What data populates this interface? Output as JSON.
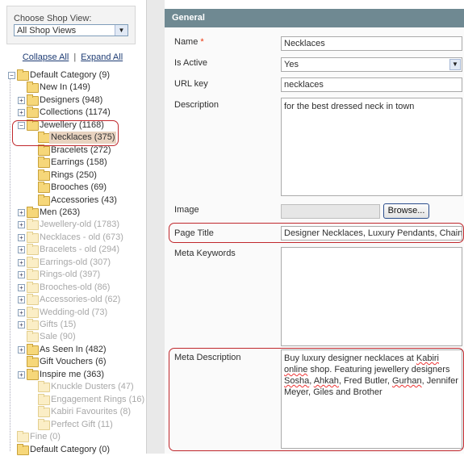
{
  "shop_view": {
    "label": "Choose Shop View:",
    "selected": "All Shop Views"
  },
  "tree_controls": {
    "collapse_all": "Collapse All",
    "separator": "|",
    "expand_all": "Expand All"
  },
  "tree": [
    {
      "label": "Default Category (9)",
      "exp": "−",
      "dim": false
    },
    {
      "label": "New In (149)",
      "exp": "",
      "dim": false
    },
    {
      "label": "Designers (948)",
      "exp": "+",
      "dim": false
    },
    {
      "label": "Collections (1174)",
      "exp": "+",
      "dim": false
    },
    {
      "label": "Jewellery (1168)",
      "exp": "−",
      "dim": false
    },
    {
      "label": "Necklaces (375)",
      "exp": "",
      "dim": false,
      "selected": true
    },
    {
      "label": "Bracelets (272)",
      "exp": "",
      "dim": false
    },
    {
      "label": "Earrings (158)",
      "exp": "",
      "dim": false
    },
    {
      "label": "Rings (250)",
      "exp": "",
      "dim": false
    },
    {
      "label": "Brooches (69)",
      "exp": "",
      "dim": false
    },
    {
      "label": "Accessories (43)",
      "exp": "",
      "dim": false
    },
    {
      "label": "Men (263)",
      "exp": "+",
      "dim": false
    },
    {
      "label": "Jewellery-old (1783)",
      "exp": "+",
      "dim": true
    },
    {
      "label": "Necklaces - old (673)",
      "exp": "+",
      "dim": true
    },
    {
      "label": "Bracelets - old (294)",
      "exp": "+",
      "dim": true
    },
    {
      "label": "Earrings-old (307)",
      "exp": "+",
      "dim": true
    },
    {
      "label": "Rings-old (397)",
      "exp": "+",
      "dim": true
    },
    {
      "label": "Brooches-old (86)",
      "exp": "+",
      "dim": true
    },
    {
      "label": "Accessories-old (62)",
      "exp": "+",
      "dim": true
    },
    {
      "label": "Wedding-old (73)",
      "exp": "+",
      "dim": true
    },
    {
      "label": "Gifts (15)",
      "exp": "+",
      "dim": true
    },
    {
      "label": "Sale (90)",
      "exp": "",
      "dim": true
    },
    {
      "label": "As Seen In (482)",
      "exp": "+",
      "dim": false
    },
    {
      "label": "Gift Vouchers (6)",
      "exp": "",
      "dim": false
    },
    {
      "label": "Inspire me (363)",
      "exp": "+",
      "dim": false
    },
    {
      "label": "Knuckle Dusters (47)",
      "exp": "",
      "dim": true
    },
    {
      "label": "Engagement Rings (16)",
      "exp": "",
      "dim": true
    },
    {
      "label": "Kabiri Favourites (8)",
      "exp": "",
      "dim": true
    },
    {
      "label": "Perfect Gift (11)",
      "exp": "",
      "dim": true
    },
    {
      "label": "Fine (0)",
      "exp": "",
      "dim": true
    },
    {
      "label": "Default Category (0)",
      "exp": "",
      "dim": false
    }
  ],
  "form": {
    "header": "General",
    "name_label": "Name",
    "required_mark": "*",
    "name_value": "Necklaces",
    "active_label": "Is Active",
    "active_value": "Yes",
    "url_label": "URL key",
    "url_value": "necklaces",
    "desc_label": "Description",
    "desc_value": "for the best dressed neck in town",
    "image_label": "Image",
    "browse_label": "Browse...",
    "page_title_label": "Page Title",
    "page_title_value": "Designer Necklaces, Luxury Pendants, Chains &",
    "meta_keywords_label": "Meta Keywords",
    "meta_keywords_value": "",
    "meta_desc_label": "Meta Description",
    "meta_desc": {
      "p1": "Buy luxury designer necklaces at ",
      "w1": "Kabiri",
      "p2": " ",
      "w2": "online",
      "p3": " shop. Featuring jewellery designers ",
      "w3": "Sosha",
      "p4": ", ",
      "w4": "Ahkah",
      "p5": ", Fred Butler, ",
      "w5": "Gurhan",
      "p6": ", Jennifer Meyer, Giles and Brother"
    }
  }
}
